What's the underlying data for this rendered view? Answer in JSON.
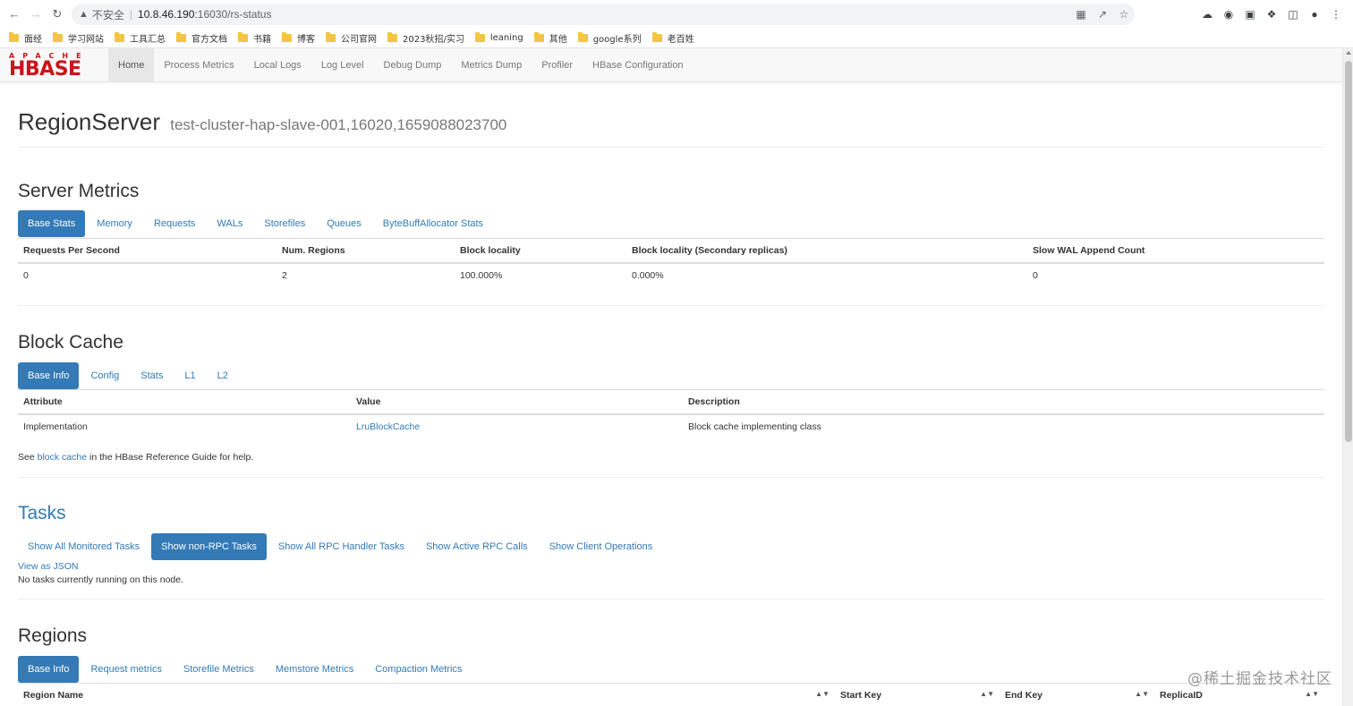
{
  "browser": {
    "insecure_label": "不安全",
    "url_host": "10.8.46.190",
    "url_path": ":16030/rs-status",
    "bookmarks": [
      "面经",
      "学习网站",
      "工具汇总",
      "官方文档",
      "书籍",
      "博客",
      "公司官网",
      "2023秋招/实习",
      "leaning",
      "其他",
      "google系列",
      "老百姓"
    ]
  },
  "navbar": {
    "logo_apache": "APACHE",
    "logo_hbase": "HBASE",
    "links": [
      "Home",
      "Process Metrics",
      "Local Logs",
      "Log Level",
      "Debug Dump",
      "Metrics Dump",
      "Profiler",
      "HBase Configuration"
    ]
  },
  "header": {
    "title": "RegionServer",
    "subtitle": "test-cluster-hap-slave-001,16020,1659088023700"
  },
  "server_metrics": {
    "title": "Server Metrics",
    "tabs": [
      "Base Stats",
      "Memory",
      "Requests",
      "WALs",
      "Storefiles",
      "Queues",
      "ByteBuffAllocator Stats"
    ],
    "columns": [
      "Requests Per Second",
      "Num. Regions",
      "Block locality",
      "Block locality (Secondary replicas)",
      "Slow WAL Append Count"
    ],
    "row": [
      "0",
      "2",
      "100.000%",
      "0.000%",
      "0"
    ]
  },
  "block_cache": {
    "title": "Block Cache",
    "tabs": [
      "Base Info",
      "Config",
      "Stats",
      "L1",
      "L2"
    ],
    "columns": [
      "Attribute",
      "Value",
      "Description"
    ],
    "row": [
      "Implementation",
      "LruBlockCache",
      "Block cache implementing class"
    ],
    "help_prefix": "See",
    "help_link": "block cache",
    "help_suffix": "in the HBase Reference Guide for help."
  },
  "tasks": {
    "title": "Tasks",
    "tabs": [
      "Show All Monitored Tasks",
      "Show non-RPC Tasks",
      "Show All RPC Handler Tasks",
      "Show Active RPC Calls",
      "Show Client Operations"
    ],
    "json_link": "View as JSON",
    "empty_text": "No tasks currently running on this node."
  },
  "regions": {
    "title": "Regions",
    "tabs": [
      "Base Info",
      "Request metrics",
      "Storefile Metrics",
      "Memstore Metrics",
      "Compaction Metrics"
    ],
    "columns": [
      "Region Name",
      "Start Key",
      "End Key",
      "ReplicaID"
    ]
  },
  "watermark": "@稀土掘金技术社区"
}
